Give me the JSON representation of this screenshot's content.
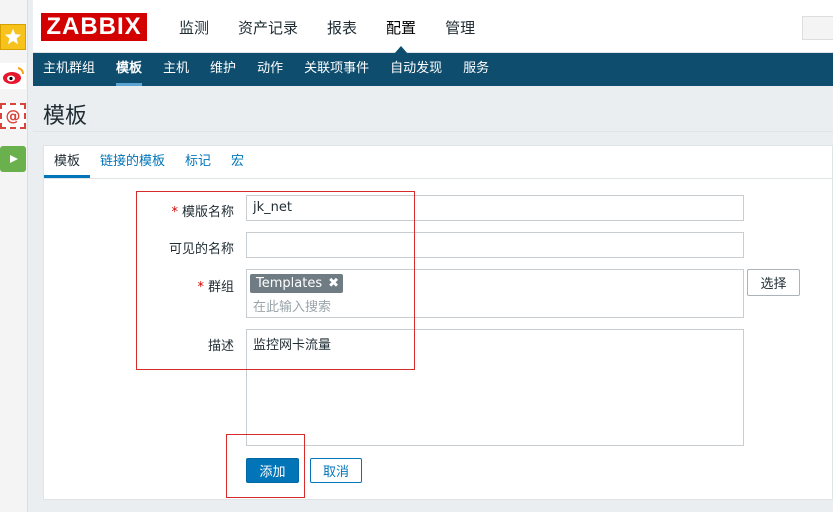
{
  "logo": {
    "text": "ZABBIX"
  },
  "top_nav": [
    {
      "label": "监测"
    },
    {
      "label": "资产记录"
    },
    {
      "label": "报表"
    },
    {
      "label": "配置",
      "active": true
    },
    {
      "label": "管理"
    }
  ],
  "sub_nav": [
    {
      "label": "主机群组"
    },
    {
      "label": "模板",
      "active": true
    },
    {
      "label": "主机"
    },
    {
      "label": "维护"
    },
    {
      "label": "动作"
    },
    {
      "label": "关联项事件"
    },
    {
      "label": "自动发现"
    },
    {
      "label": "服务"
    }
  ],
  "page": {
    "title": "模板"
  },
  "tabs": [
    {
      "label": "模板",
      "active": true
    },
    {
      "label": "链接的模板"
    },
    {
      "label": "标记"
    },
    {
      "label": "宏"
    }
  ],
  "form": {
    "template_name": {
      "label": "模版名称",
      "required_mark": "*",
      "value": "jk_net"
    },
    "visible_name": {
      "label": "可见的名称",
      "value": ""
    },
    "groups": {
      "label": "群组",
      "required_mark": "*",
      "chip": "Templates",
      "chip_remove": "✖",
      "placeholder": "在此输入搜索",
      "select_label": "选择"
    },
    "description": {
      "label": "描述",
      "value": "监控网卡流量"
    },
    "add_label": "添加",
    "cancel_label": "取消"
  },
  "colors": {
    "brand": "#d40000",
    "nav_bg": "#0e4d6e",
    "link": "#0275b8",
    "annotation": "#d62b2b"
  }
}
